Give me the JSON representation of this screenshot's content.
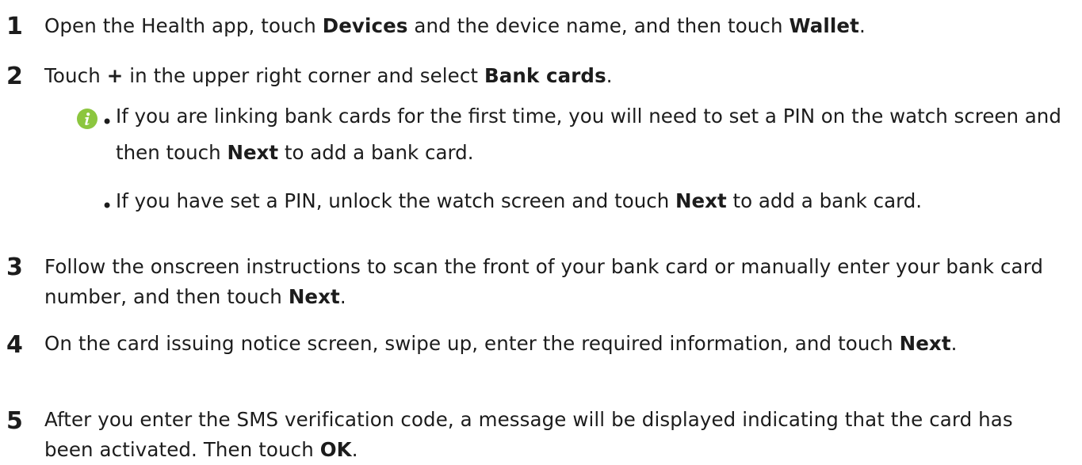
{
  "steps": [
    {
      "number": "1",
      "parts": [
        "Open the Health app, touch ",
        "Devices",
        " and the device name, and then touch ",
        "Wallet",
        "."
      ]
    },
    {
      "number": "2",
      "parts": [
        "Touch ",
        "+",
        " in the upper right corner and select ",
        "Bank cards",
        "."
      ]
    },
    {
      "number": "3",
      "parts": [
        "Follow the onscreen instructions to scan the front of your bank card or manually enter your bank card number, and then touch ",
        "Next",
        "."
      ]
    },
    {
      "number": "4",
      "parts": [
        "On the card issuing notice screen, swipe up, enter the required information, and touch ",
        "Next",
        "."
      ]
    },
    {
      "number": "5",
      "parts": [
        "After you enter the SMS verification code, a message will be displayed indicating that the card has been activated. Then touch ",
        "OK",
        "."
      ]
    }
  ],
  "note": {
    "icon": "info-icon",
    "icon_color": "#8cc63f",
    "bullet_glyph": "•",
    "items": [
      {
        "parts": [
          "If you are linking bank cards for the first time, you will need to set a PIN on the watch screen and then touch ",
          "Next",
          " to add a bank card."
        ]
      },
      {
        "parts": [
          "If you have set a PIN, unlock the watch screen and touch ",
          "Next",
          " to add a bank card."
        ]
      }
    ]
  }
}
